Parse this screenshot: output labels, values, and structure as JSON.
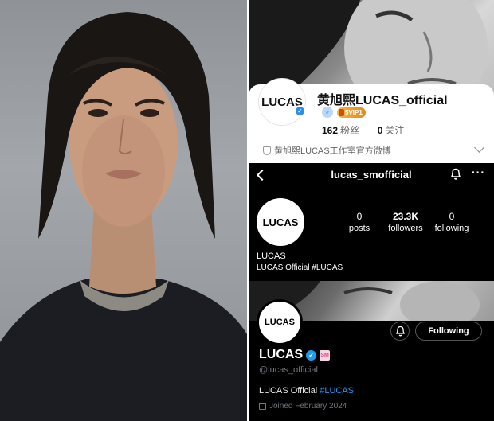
{
  "weibo": {
    "avatar_text": "LUCAS",
    "name": "黄旭熙LUCAS_official",
    "svip_label": "5VIP1",
    "fans_count": "162",
    "fans_label": "粉丝",
    "follow_count": "0",
    "follow_label": "关注",
    "description": "黄旭熙LUCAS工作室官方微博"
  },
  "instagram": {
    "handle": "lucas_smofficial",
    "avatar_text": "LUCAS",
    "posts_count": "0",
    "posts_label": "posts",
    "followers_count": "23.3K",
    "followers_label": "followers",
    "following_count": "0",
    "following_label": "following",
    "name": "LUCAS",
    "bio": "LUCAS Official #LUCAS",
    "more_glyph": "···"
  },
  "x": {
    "avatar_text": "LUCAS",
    "following_button": "Following",
    "display_name": "LUCAS",
    "username": "@lucas_official",
    "bio_text": "LUCAS Official ",
    "bio_hashtag": "#LUCAS",
    "joined": "Joined February 2024"
  },
  "icons": {
    "verified": "✓",
    "gender": "♂",
    "affiliate": "SM"
  }
}
